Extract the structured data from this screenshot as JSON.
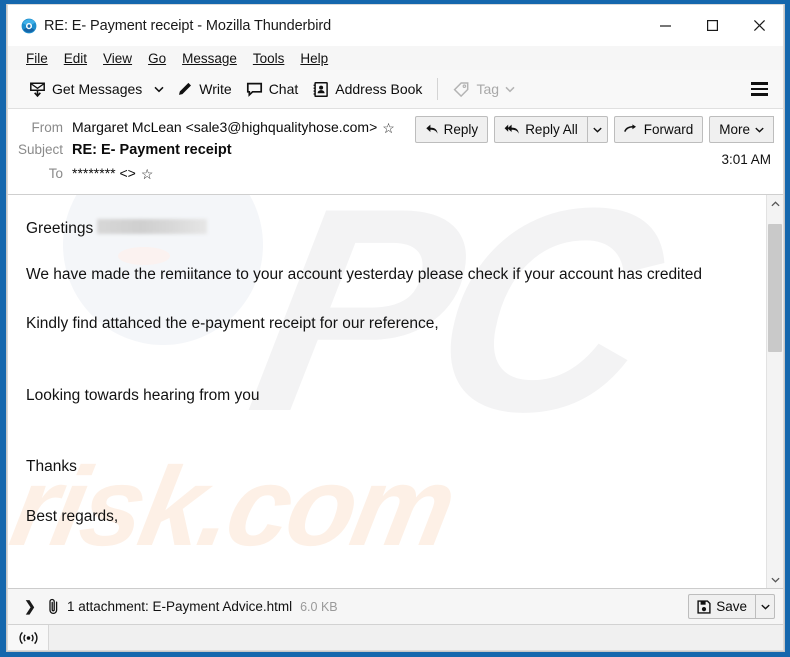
{
  "window": {
    "title": "RE: E- Payment receipt - Mozilla Thunderbird",
    "app_icon": "thunderbird-icon",
    "controls": {
      "minimize": "minimize-icon",
      "maximize": "maximize-icon",
      "close": "close-icon"
    },
    "border_color": "#1567ad"
  },
  "menubar": {
    "items": [
      {
        "label": "File",
        "accel": "F"
      },
      {
        "label": "Edit",
        "accel": "E"
      },
      {
        "label": "View",
        "accel": "V"
      },
      {
        "label": "Go",
        "accel": "G"
      },
      {
        "label": "Message",
        "accel": "M"
      },
      {
        "label": "Tools",
        "accel": "T"
      },
      {
        "label": "Help",
        "accel": "H"
      }
    ]
  },
  "toolbar": {
    "get_messages": "Get Messages",
    "write": "Write",
    "chat": "Chat",
    "address_book": "Address Book",
    "tag": "Tag",
    "tag_disabled": true,
    "menu_button": "app-menu"
  },
  "message_header": {
    "from_label": "From",
    "from_value": "Margaret McLean <sale3@highqualityhose.com>",
    "subject_label": "Subject",
    "subject_value": "RE: E- Payment receipt",
    "to_label": "To",
    "to_value": "******** <>",
    "time": "3:01 AM",
    "star_glyph": "☆"
  },
  "actions": {
    "reply": "Reply",
    "reply_all": "Reply All",
    "forward": "Forward",
    "more": "More"
  },
  "message_body": {
    "greeting_prefix": "Greetings",
    "greeting_redacted": true,
    "paragraphs": [
      "We have made the remiitance to your account yesterday please check if your account has credited",
      "Kindly find attahced the e-payment receipt for our reference,",
      "Looking towards hearing from you",
      "Thanks",
      "Best regards,"
    ],
    "watermark_primary": "PC",
    "watermark_secondary": "risk.com"
  },
  "attachment": {
    "expand_glyph": "❯",
    "summary": "1 attachment: E-Payment Advice.html",
    "size": "6.0 KB",
    "save_label": "Save"
  },
  "statusbar": {
    "icon": "offline-status-icon"
  }
}
